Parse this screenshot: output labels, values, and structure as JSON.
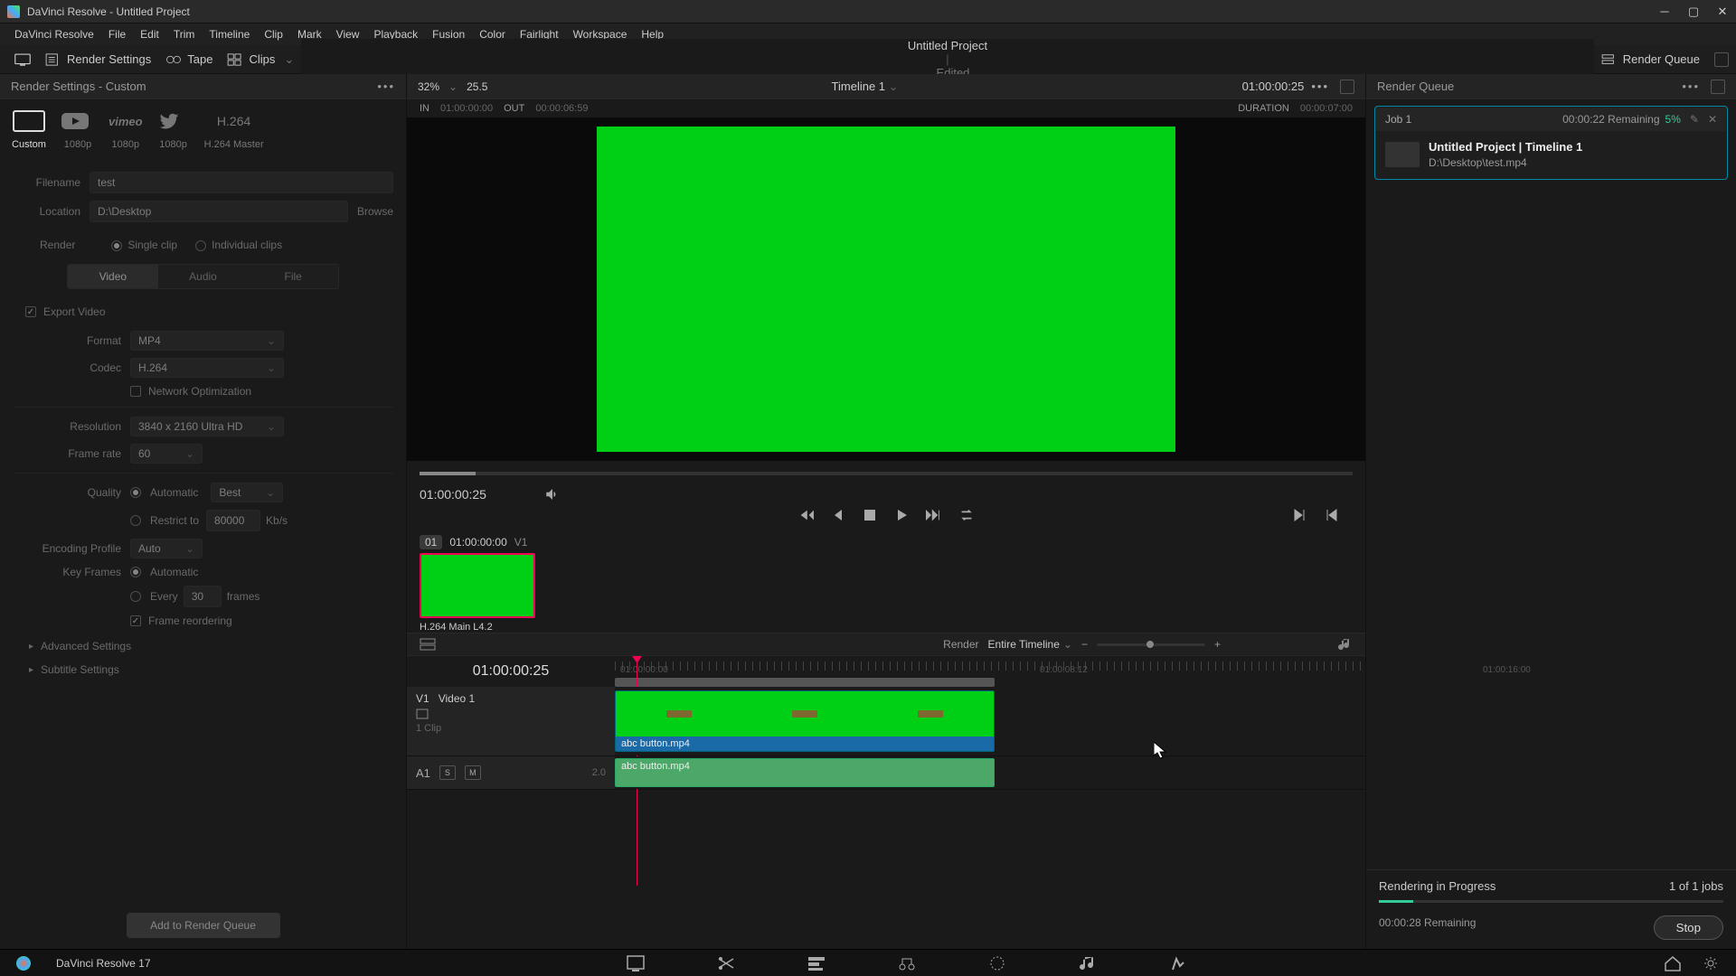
{
  "window": {
    "title": "DaVinci Resolve - Untitled Project"
  },
  "menu": [
    "DaVinci Resolve",
    "File",
    "Edit",
    "Trim",
    "Timeline",
    "Clip",
    "Mark",
    "View",
    "Playback",
    "Fusion",
    "Color",
    "Fairlight",
    "Workspace",
    "Help"
  ],
  "toolbar": {
    "render_settings": "Render Settings",
    "tape": "Tape",
    "clips": "Clips",
    "project": "Untitled Project",
    "status": "Edited",
    "render_queue": "Render Queue"
  },
  "render_settings": {
    "title": "Render Settings - Custom",
    "presets": [
      {
        "label": "Custom",
        "sub": ""
      },
      {
        "label": "YouTube",
        "sub": "1080p"
      },
      {
        "label": "Vimeo",
        "sub": "1080p"
      },
      {
        "label": "Twitter",
        "sub": "1080p"
      },
      {
        "label": "H.264",
        "sub": "H.264 Master"
      }
    ],
    "filename_label": "Filename",
    "filename": "test",
    "location_label": "Location",
    "location": "D:\\Desktop",
    "browse": "Browse",
    "render_label": "Render",
    "mode_single": "Single clip",
    "mode_individual": "Individual clips",
    "tabs": [
      "Video",
      "Audio",
      "File"
    ],
    "export_video": "Export Video",
    "format_label": "Format",
    "format": "MP4",
    "codec_label": "Codec",
    "codec": "H.264",
    "net_opt": "Network Optimization",
    "resolution_label": "Resolution",
    "resolution": "3840 x 2160 Ultra HD",
    "framerate_label": "Frame rate",
    "framerate": "60",
    "quality_label": "Quality",
    "quality_auto": "Automatic",
    "quality_sel": "Best",
    "restrict_label": "Restrict to",
    "restrict_val": "80000",
    "restrict_unit": "Kb/s",
    "encprof_label": "Encoding Profile",
    "encprof": "Auto",
    "keyframes_label": "Key Frames",
    "kf_auto": "Automatic",
    "kf_every": "Every",
    "kf_val": "30",
    "kf_unit": "frames",
    "frame_reorder": "Frame reordering",
    "advanced": "Advanced Settings",
    "subtitle": "Subtitle Settings",
    "add_btn": "Add to Render Queue"
  },
  "viewer": {
    "zoom": "32%",
    "fps": "25.5",
    "name": "Timeline 1",
    "timecode": "01:00:00:25",
    "in_label": "IN",
    "in_tc": "01:00:00:00",
    "out_label": "OUT",
    "out_tc": "00:00:06:59",
    "dur_label": "DURATION",
    "dur_tc": "00:00:07:00",
    "scrub_tc": "01:00:00:25",
    "thumb_num": "01",
    "thumb_tc": "01:00:00:00",
    "thumb_track": "V1",
    "thumb_name": "H.264 Main L4.2"
  },
  "timeline": {
    "render_label": "Render",
    "scope": "Entire Timeline",
    "tc": "01:00:00:25",
    "ruler": [
      "01:00:00:00",
      "01:00:08:12",
      "01:00:16:00"
    ],
    "v1": "V1",
    "v1_name": "Video 1",
    "v1_clips": "1 Clip",
    "a1": "A1",
    "a1_ch": "2.0",
    "clip_name": "abc button.mp4"
  },
  "queue": {
    "title": "Render Queue",
    "job_id": "Job 1",
    "job_eta": "00:00:22 Remaining",
    "job_pct": "5%",
    "job_title": "Untitled Project | Timeline 1",
    "job_path": "D:\\Desktop\\test.mp4",
    "progress_title": "Rendering in Progress",
    "progress_count": "1 of 1 jobs",
    "overall_eta": "00:00:28 Remaining",
    "stop": "Stop"
  },
  "bottom": {
    "version": "DaVinci Resolve 17"
  }
}
